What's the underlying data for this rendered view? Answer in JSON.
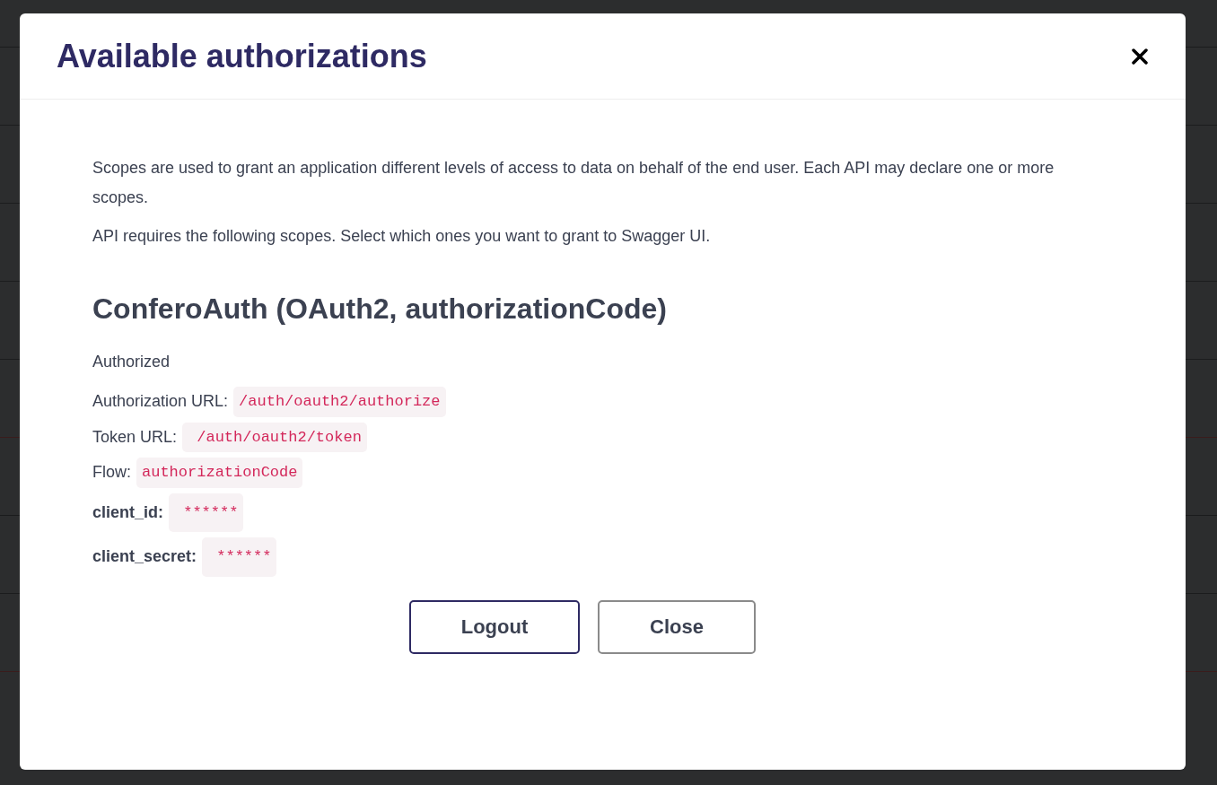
{
  "modal": {
    "title": "Available authorizations",
    "description": [
      "Scopes are used to grant an application different levels of access to data on behalf of the end user. Each API may declare one or more scopes.",
      "API requires the following scopes. Select which ones you want to grant to Swagger UI."
    ],
    "scheme": {
      "heading": "ConferoAuth (OAuth2, authorizationCode)",
      "status": "Authorized",
      "fields": [
        {
          "label": "Authorization URL:",
          "value": "/auth/oauth2/authorize",
          "kind": "plain"
        },
        {
          "label": "Token URL:",
          "value": " /auth/oauth2/token",
          "kind": "plain"
        },
        {
          "label": "Flow:",
          "value": "authorizationCode",
          "kind": "plain"
        },
        {
          "label": "client_id:",
          "value": " ******",
          "kind": "bold"
        },
        {
          "label": "client_secret:",
          "value": " ******",
          "kind": "bold"
        }
      ]
    },
    "buttons": [
      {
        "label": "Logout",
        "kind": "primary"
      },
      {
        "label": "Close",
        "kind": "secondary"
      }
    ]
  }
}
